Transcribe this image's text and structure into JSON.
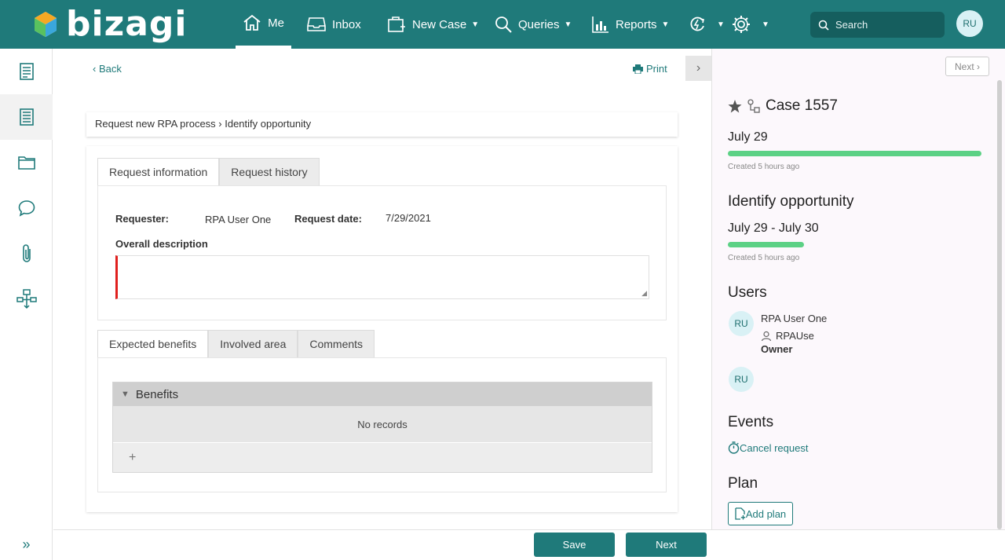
{
  "colors": {
    "brand": "#1f7a7a",
    "progress": "#5cd185",
    "required": "#e0201e"
  },
  "header": {
    "logo_text": "bizagi",
    "nav": [
      {
        "label": "Me",
        "icon": "home-icon"
      },
      {
        "label": "Inbox",
        "icon": "inbox-icon"
      },
      {
        "label": "New Case",
        "icon": "new-case-icon"
      },
      {
        "label": "Queries",
        "icon": "search-icon"
      },
      {
        "label": "Reports",
        "icon": "reports-icon"
      }
    ],
    "search_placeholder": "Search",
    "user_initials": "RU"
  },
  "sidebar": {
    "items": [
      "work-item-icon",
      "case-details-icon",
      "folder-icon",
      "chat-icon",
      "attachment-icon",
      "process-map-icon"
    ]
  },
  "main": {
    "back_label": "Back",
    "print_label": "Print",
    "breadcrumb": "Request new RPA process › Identify opportunity",
    "tabs": [
      {
        "label": "Request information"
      },
      {
        "label": "Request history"
      }
    ],
    "requester_label": "Requester:",
    "requester_value": "RPA User One",
    "request_date_label": "Request date:",
    "request_date_value": "7/29/2021",
    "overall_description_label": "Overall description",
    "overall_description_value": "",
    "subtabs": [
      {
        "label": "Expected benefits"
      },
      {
        "label": "Involved area"
      },
      {
        "label": "Comments"
      }
    ],
    "grid": {
      "title": "Benefits",
      "empty_text": "No records",
      "add_symbol": "+"
    }
  },
  "footer": {
    "save_label": "Save",
    "next_label": "Next"
  },
  "right_panel": {
    "next_label": "Next",
    "case_title": "Case 1557",
    "case_date": "July 29",
    "case_created": "Created 5 hours ago",
    "case_progress": 1.0,
    "task_title": "Identify opportunity",
    "task_dates": "July 29 - July 30",
    "task_created": "Created 5 hours ago",
    "task_progress": 0.3,
    "users_title": "Users",
    "user_initials": "RU",
    "user_name": "RPA User One",
    "user_login": "RPAUse",
    "user_role": "Owner",
    "second_user_initials": "RU",
    "events_title": "Events",
    "event_cancel": "Cancel request",
    "plan_title": "Plan",
    "add_plan_label": "Add plan"
  }
}
